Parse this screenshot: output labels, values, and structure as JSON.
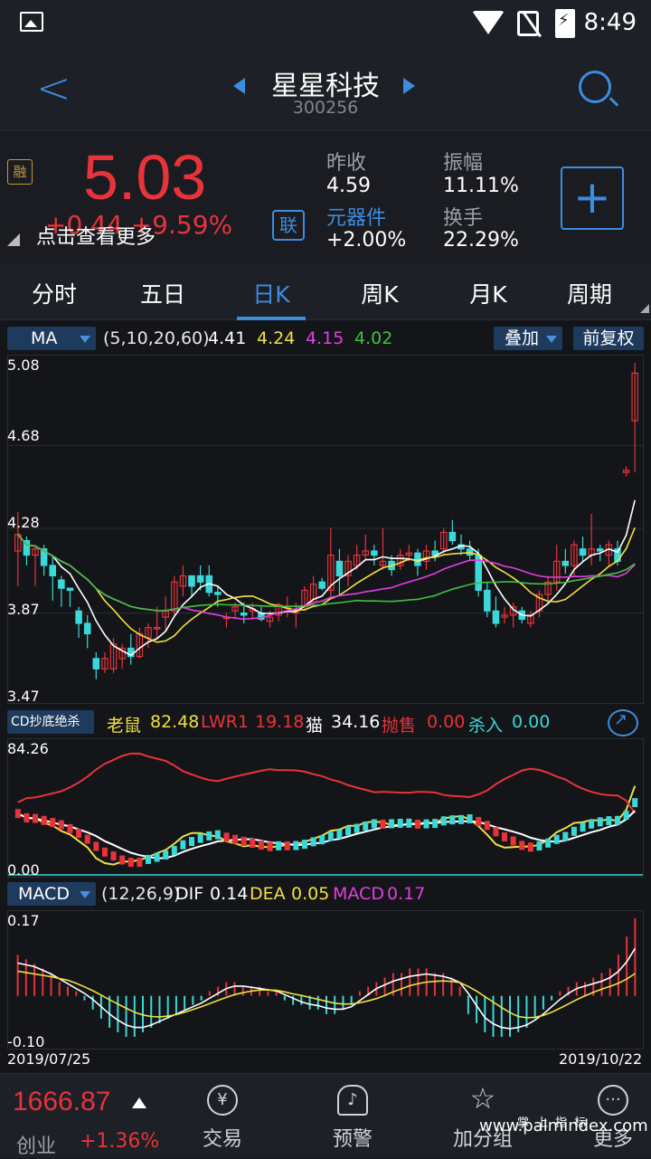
{
  "status": {
    "time": "8:49"
  },
  "header": {
    "title": "星星科技",
    "code": "300256"
  },
  "quote": {
    "badge": "融",
    "price": "5.03",
    "change": "+0.44 +9.59%",
    "tooltip": "点击查看更多",
    "lian": "联",
    "prev_close_label": "昨收",
    "prev_close": "4.59",
    "amplitude_label": "振幅",
    "amplitude": "11.11%",
    "sector_label": "元器件",
    "sector_change": "+2.00%",
    "turnover_label": "换手",
    "turnover": "22.29%",
    "add_label": "+"
  },
  "tabs": [
    {
      "label": "分时"
    },
    {
      "label": "五日"
    },
    {
      "label": "日K"
    },
    {
      "label": "周K"
    },
    {
      "label": "月K"
    },
    {
      "label": "周期"
    }
  ],
  "active_tab": "日K",
  "ma_bar": {
    "selector": "MA",
    "params": "(5,10,20,60)",
    "v1": "4.41",
    "v2": "4.24",
    "v3": "4.15",
    "v4": "4.02",
    "overlay": "叠加",
    "adjust": "前复权",
    "colors": {
      "v1": "#ffffff",
      "v2": "#f0e040",
      "v3": "#e040e0",
      "v4": "#40c040"
    }
  },
  "kline_axis": {
    "top": "5.08",
    "l2": "4.68",
    "l3": "4.28",
    "l4": "3.87",
    "bottom": "3.47"
  },
  "cd_bar": {
    "selector": "CD抄底绝杀",
    "mouse_label": "老鼠",
    "mouse": "82.48",
    "lwr_label": "LWR1",
    "lwr": "19.18",
    "cat_label": "猫",
    "cat": "34.16",
    "sell_label": "抛售",
    "sell": "0.00",
    "kill_label": "杀入",
    "kill": "0.00"
  },
  "cd_axis": {
    "top": "84.26",
    "bottom": "0.00"
  },
  "macd_bar": {
    "selector": "MACD",
    "params": "(12,26,9)",
    "dif_label": "DIF",
    "dif": "0.14",
    "dea_label": "DEA",
    "dea": "0.05",
    "macd_label": "MACD",
    "macd": "0.17"
  },
  "macd_axis": {
    "top": "0.17",
    "bottom": "-0.10"
  },
  "dates": {
    "start": "2019/07/25",
    "end": "2019/10/22"
  },
  "bottom": {
    "index_value": "1666.87",
    "index_name": "创业",
    "index_change": "+1.36%",
    "nav": [
      {
        "label": "交易",
        "icon": "yuan-icon"
      },
      {
        "label": "预警",
        "icon": "bell-icon"
      },
      {
        "label": "加分组",
        "icon": "star-icon"
      },
      {
        "label": "更多",
        "icon": "more-icon"
      }
    ],
    "watermark": "www.palmindex.com",
    "watermark_cn": "掌上指标"
  },
  "chart_data": [
    {
      "type": "candlestick",
      "title": "",
      "ylim": [
        3.47,
        5.08
      ],
      "x": [
        "2019/07/25",
        "2019/10/22"
      ],
      "series": [
        {
          "name": "MA5",
          "value": 4.41
        },
        {
          "name": "MA10",
          "value": 4.24
        },
        {
          "name": "MA20",
          "value": 4.15
        },
        {
          "name": "MA60",
          "value": 4.02
        }
      ],
      "candles": [
        [
          4.17,
          4.36,
          4.0,
          4.25
        ],
        [
          4.22,
          4.24,
          4.1,
          4.15
        ],
        [
          4.15,
          4.2,
          4.0,
          4.18
        ],
        [
          4.18,
          4.2,
          4.05,
          4.1
        ],
        [
          4.1,
          4.15,
          3.93,
          4.05
        ],
        [
          4.03,
          4.05,
          3.9,
          3.99
        ],
        [
          3.99,
          3.99,
          3.9,
          3.98
        ],
        [
          3.88,
          3.9,
          3.75,
          3.82
        ],
        [
          3.82,
          3.86,
          3.7,
          3.77
        ],
        [
          3.65,
          3.68,
          3.55,
          3.6
        ],
        [
          3.6,
          3.68,
          3.58,
          3.65
        ],
        [
          3.6,
          3.75,
          3.58,
          3.72
        ],
        [
          3.65,
          3.72,
          3.6,
          3.7
        ],
        [
          3.7,
          3.77,
          3.62,
          3.66
        ],
        [
          3.66,
          3.8,
          3.65,
          3.77
        ],
        [
          3.75,
          3.82,
          3.7,
          3.8
        ],
        [
          3.8,
          3.9,
          3.75,
          3.8
        ],
        [
          3.85,
          3.95,
          3.78,
          3.88
        ],
        [
          3.88,
          4.05,
          3.85,
          4.02
        ],
        [
          4.0,
          4.1,
          3.95,
          4.05
        ],
        [
          4.05,
          4.05,
          3.95,
          4.0
        ],
        [
          4.05,
          4.1,
          3.98,
          4.02
        ],
        [
          4.05,
          4.1,
          3.95,
          3.97
        ],
        [
          3.97,
          4.0,
          3.9,
          3.96
        ],
        [
          3.85,
          3.87,
          3.8,
          3.85
        ],
        [
          3.88,
          3.92,
          3.84,
          3.9
        ],
        [
          3.87,
          3.92,
          3.82,
          3.86
        ],
        [
          3.88,
          3.92,
          3.84,
          3.89
        ],
        [
          3.87,
          3.9,
          3.83,
          3.84
        ],
        [
          3.83,
          3.88,
          3.8,
          3.85
        ],
        [
          3.86,
          3.92,
          3.83,
          3.91
        ],
        [
          3.9,
          3.95,
          3.85,
          3.9
        ],
        [
          3.87,
          3.92,
          3.8,
          3.88
        ],
        [
          3.9,
          4.0,
          3.88,
          3.98
        ],
        [
          3.92,
          4.05,
          3.9,
          4.01
        ],
        [
          4.02,
          4.04,
          3.98,
          3.99
        ],
        [
          3.98,
          4.28,
          3.95,
          4.15
        ],
        [
          4.12,
          4.18,
          3.95,
          4.05
        ],
        [
          4.05,
          4.15,
          4.0,
          4.12
        ],
        [
          4.1,
          4.2,
          4.08,
          4.15
        ],
        [
          4.15,
          4.25,
          4.12,
          4.17
        ],
        [
          4.17,
          4.2,
          4.1,
          4.15
        ],
        [
          4.1,
          4.28,
          4.08,
          4.12
        ],
        [
          4.12,
          4.15,
          4.05,
          4.08
        ],
        [
          4.1,
          4.18,
          4.08,
          4.15
        ],
        [
          4.15,
          4.2,
          4.12,
          4.16
        ],
        [
          4.16,
          4.18,
          4.05,
          4.1
        ],
        [
          4.12,
          4.2,
          4.08,
          4.17
        ],
        [
          4.17,
          4.22,
          4.12,
          4.15
        ],
        [
          4.18,
          4.28,
          4.15,
          4.26
        ],
        [
          4.26,
          4.32,
          4.2,
          4.22
        ],
        [
          4.2,
          4.25,
          4.15,
          4.18
        ],
        [
          4.18,
          4.22,
          4.12,
          4.15
        ],
        [
          4.15,
          4.18,
          3.95,
          3.98
        ],
        [
          3.98,
          4.02,
          3.85,
          3.88
        ],
        [
          3.88,
          3.95,
          3.8,
          3.82
        ],
        [
          3.85,
          3.9,
          3.82,
          3.86
        ],
        [
          3.86,
          3.92,
          3.8,
          3.9
        ],
        [
          3.88,
          3.9,
          3.82,
          3.84
        ],
        [
          3.82,
          3.88,
          3.8,
          3.86
        ],
        [
          3.88,
          3.98,
          3.85,
          3.96
        ],
        [
          3.96,
          4.05,
          3.92,
          4.02
        ],
        [
          4.02,
          4.2,
          3.98,
          4.12
        ],
        [
          4.12,
          4.18,
          4.06,
          4.1
        ],
        [
          4.1,
          4.22,
          4.05,
          4.2
        ],
        [
          4.18,
          4.24,
          4.12,
          4.15
        ],
        [
          4.15,
          4.35,
          4.1,
          4.18
        ],
        [
          4.18,
          4.2,
          4.12,
          4.17
        ],
        [
          4.15,
          4.22,
          4.1,
          4.2
        ],
        [
          4.18,
          4.22,
          4.1,
          4.12
        ],
        [
          4.55,
          4.58,
          4.53,
          4.56
        ],
        [
          4.8,
          5.08,
          4.55,
          5.03
        ]
      ]
    },
    {
      "type": "line",
      "title": "CD抄底绝杀",
      "ylim": [
        0,
        84.26
      ],
      "series": [
        {
          "name": "老鼠",
          "value": 82.48
        },
        {
          "name": "LWR1",
          "value": 19.18
        },
        {
          "name": "猫",
          "value": 34.16
        },
        {
          "name": "抛售",
          "value": 0.0
        },
        {
          "name": "杀入",
          "value": 0.0
        }
      ]
    },
    {
      "type": "bar",
      "title": "MACD",
      "ylim": [
        -0.1,
        0.17
      ],
      "series": [
        {
          "name": "DIF",
          "value": 0.14
        },
        {
          "name": "DEA",
          "value": 0.05
        },
        {
          "name": "MACD",
          "value": 0.17
        }
      ],
      "values": [
        0.09,
        0.08,
        0.07,
        0.06,
        0.05,
        0.03,
        0.02,
        0.01,
        -0.01,
        -0.03,
        -0.05,
        -0.07,
        -0.08,
        -0.09,
        -0.09,
        -0.08,
        -0.07,
        -0.06,
        -0.05,
        -0.04,
        -0.03,
        -0.02,
        -0.01,
        0.01,
        0.02,
        0.03,
        0.03,
        0.02,
        0.02,
        0.02,
        0.01,
        0.01,
        -0.01,
        -0.02,
        -0.02,
        -0.03,
        -0.03,
        -0.04,
        -0.04,
        -0.03,
        -0.02,
        0.01,
        0.02,
        0.03,
        0.04,
        0.05,
        0.05,
        0.06,
        0.06,
        0.06,
        0.05,
        0.05,
        0.04,
        0.02,
        -0.04,
        -0.06,
        -0.08,
        -0.09,
        -0.09,
        -0.09,
        -0.08,
        -0.07,
        -0.05,
        -0.03,
        -0.01,
        0.01,
        0.02,
        0.03,
        0.03,
        0.04,
        0.05,
        0.06,
        0.09,
        0.13,
        0.17
      ]
    }
  ]
}
